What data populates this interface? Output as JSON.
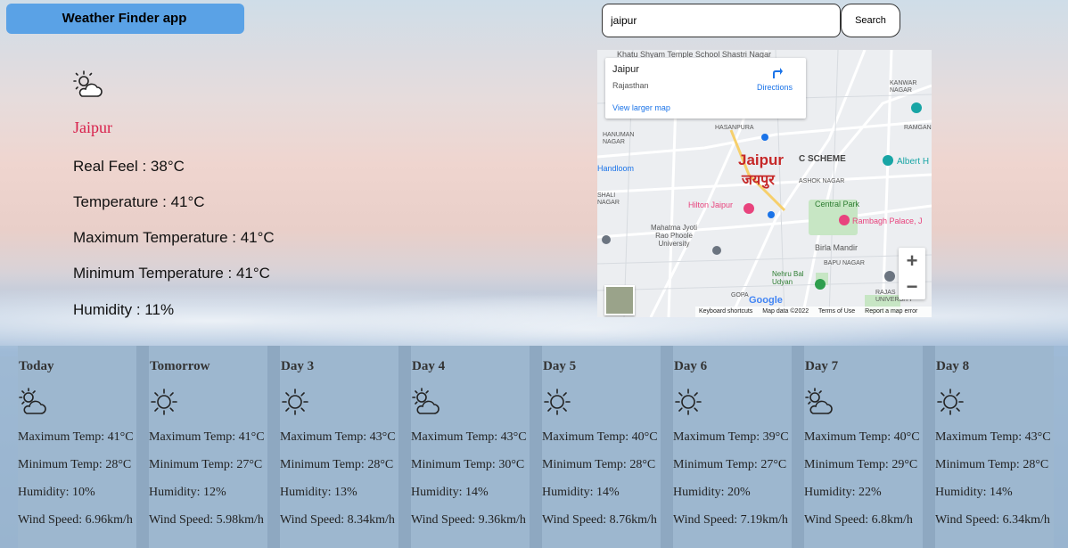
{
  "app": {
    "title": "Weather Finder app"
  },
  "search": {
    "value": "jaipur",
    "button_label": "Search"
  },
  "current": {
    "icon": "partly-cloudy-icon",
    "city": "Jaipur",
    "real_feel": "Real Feel : 38°C",
    "temperature": "Temperature : 41°C",
    "max_temp": "Maximum Temperature : 41°C",
    "min_temp": "Minimum Temperature : 41°C",
    "humidity": "Humidity : 11%"
  },
  "map": {
    "place_title": "Jaipur",
    "place_sub": "Rajasthan",
    "directions": "Directions",
    "view_larger": "View larger map",
    "city_label_en": "Jaipur",
    "city_label_hi": "जयपुर",
    "poi": {
      "khatu": "Khatu Shyam Temple",
      "school": "School Shastri Nagar",
      "hasanpura": "HASANPURA",
      "c_scheme": "C SCHEME",
      "albert": "Albert H",
      "hilton": "Hilton Jaipur",
      "central_park": "Central Park",
      "rambagh": "Rambagh Palace, J",
      "birla": "Birla Mandir",
      "mahatma": "Mahatma Jyoti Rao Phoole University",
      "nehru": "Nehru Bal Udyan",
      "bapu": "BAPU NAGAR",
      "rajas": "RAJAS UNIVERSITY",
      "handloom": "Handloom",
      "ashok": "ASHOK NAGAR",
      "shali": "SHALI NAGAR",
      "hanuman": "HANUMAN NAGAR",
      "kanwar": "KANWAR NAGAR",
      "ramgan": "RAMGAN",
      "gopa": "GOPA"
    },
    "footer": [
      "Keyboard shortcuts",
      "Map data ©2022",
      "Terms of Use",
      "Report a map error"
    ],
    "google": "Google",
    "zoom_in": "+",
    "zoom_out": "−"
  },
  "forecast": [
    {
      "day": "Today",
      "icon": "partly-cloudy-icon",
      "max": "Maximum Temp: 41°C",
      "min": "Minimum Temp: 28°C",
      "humidity": "Humidity: 10%",
      "wind": "Wind Speed: 6.96km/h"
    },
    {
      "day": "Tomorrow",
      "icon": "sun-icon",
      "max": "Maximum Temp: 41°C",
      "min": "Minimum Temp: 27°C",
      "humidity": "Humidity: 12%",
      "wind": "Wind Speed: 5.98km/h"
    },
    {
      "day": "Day 3",
      "icon": "sun-icon",
      "max": "Maximum Temp: 43°C",
      "min": "Minimum Temp: 28°C",
      "humidity": "Humidity: 13%",
      "wind": "Wind Speed: 8.34km/h"
    },
    {
      "day": "Day 4",
      "icon": "partly-cloudy-icon",
      "max": "Maximum Temp: 43°C",
      "min": "Minimum Temp: 30°C",
      "humidity": "Humidity: 14%",
      "wind": "Wind Speed: 9.36km/h"
    },
    {
      "day": "Day 5",
      "icon": "sun-icon",
      "max": "Maximum Temp: 40°C",
      "min": "Minimum Temp: 28°C",
      "humidity": "Humidity: 14%",
      "wind": "Wind Speed: 8.76km/h"
    },
    {
      "day": "Day 6",
      "icon": "sun-icon",
      "max": "Maximum Temp: 39°C",
      "min": "Minimum Temp: 27°C",
      "humidity": "Humidity: 20%",
      "wind": "Wind Speed: 7.19km/h"
    },
    {
      "day": "Day 7",
      "icon": "partly-cloudy-icon",
      "max": "Maximum Temp: 40°C",
      "min": "Minimum Temp: 29°C",
      "humidity": "Humidity: 22%",
      "wind": "Wind Speed: 6.8km/h"
    },
    {
      "day": "Day 8",
      "icon": "sun-icon",
      "max": "Maximum Temp: 43°C",
      "min": "Minimum Temp: 28°C",
      "humidity": "Humidity: 14%",
      "wind": "Wind Speed: 6.34km/h"
    }
  ]
}
